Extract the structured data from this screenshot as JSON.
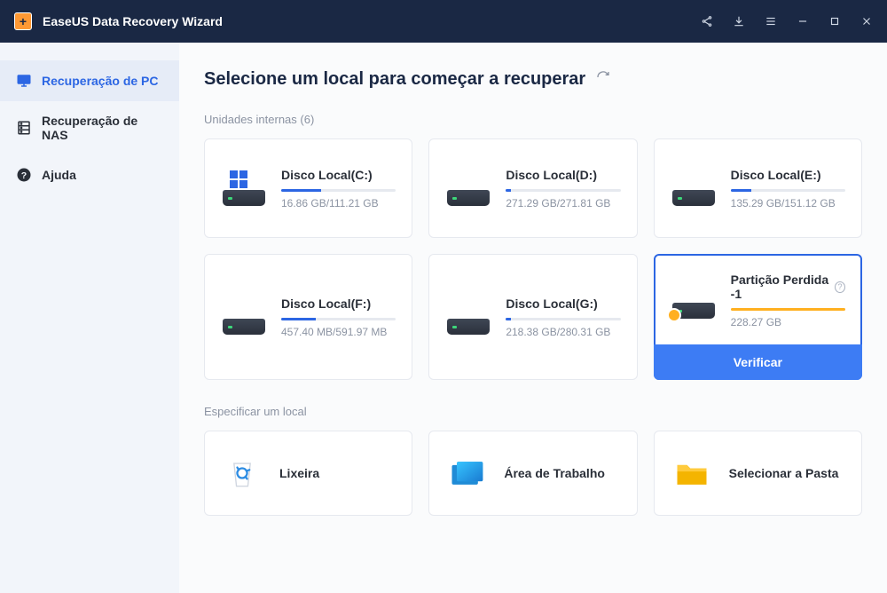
{
  "app_title": "EaseUS Data Recovery Wizard",
  "sidebar": {
    "items": [
      {
        "label": "Recuperação de PC",
        "active": true,
        "icon": "monitor"
      },
      {
        "label": "Recuperação de NAS",
        "active": false,
        "icon": "nas"
      },
      {
        "label": "Ajuda",
        "active": false,
        "icon": "help"
      }
    ]
  },
  "page_title": "Selecione um local para começar a recuperar",
  "sections": {
    "internal": {
      "label": "Unidades internas (6)"
    },
    "specify": {
      "label": "Especificar um local"
    }
  },
  "drives": [
    {
      "name": "Disco Local(C:)",
      "size": "16.86 GB/111.21 GB",
      "pct": 35,
      "system": true,
      "lost": false
    },
    {
      "name": "Disco Local(D:)",
      "size": "271.29 GB/271.81 GB",
      "pct": 4,
      "system": false,
      "lost": false
    },
    {
      "name": "Disco Local(E:)",
      "size": "135.29 GB/151.12 GB",
      "pct": 18,
      "system": false,
      "lost": false
    },
    {
      "name": "Disco Local(F:)",
      "size": "457.40 MB/591.97 MB",
      "pct": 30,
      "system": false,
      "lost": false
    },
    {
      "name": "Disco Local(G:)",
      "size": "218.38 GB/280.31 GB",
      "pct": 4,
      "system": false,
      "lost": false
    },
    {
      "name": "Partição Perdida -1",
      "size": "228.27 GB",
      "pct": 100,
      "system": false,
      "lost": true,
      "selected": true
    }
  ],
  "verify_label": "Verificar",
  "locations": [
    {
      "name": "Lixeira",
      "icon": "recycle"
    },
    {
      "name": "Área de Trabalho",
      "icon": "desktop"
    },
    {
      "name": "Selecionar a Pasta",
      "icon": "folder"
    }
  ]
}
